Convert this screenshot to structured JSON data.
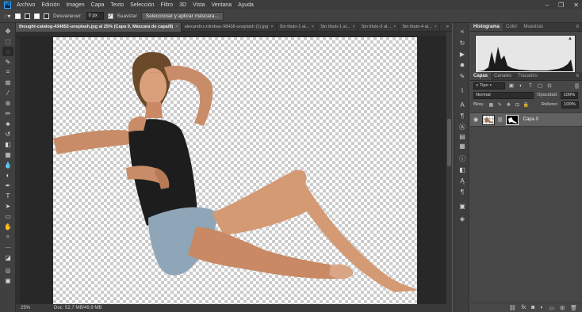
{
  "app": {
    "logo_text": "Ps"
  },
  "menu": [
    "Archivo",
    "Edición",
    "Imagen",
    "Capa",
    "Texto",
    "Selección",
    "Filtro",
    "3D",
    "Vista",
    "Ventana",
    "Ayuda"
  ],
  "options": {
    "feather_label": "Desvanecer:",
    "feather_value": "0 px",
    "smooth_label": "Suavizar",
    "select_mask_button": "Seleccionar y aplicar máscara..."
  },
  "tabs": [
    {
      "label": "thought-catalog-434852-unsplash.jpg al 25% (Capa 0, Máscara de capa/8)",
      "active": true
    },
    {
      "label": "alexandru-zdrobau-98438-unsplash (1).jpg",
      "active": false
    },
    {
      "label": "Sin título-1 al...",
      "active": false
    },
    {
      "label": "Sin título-1 al...",
      "active": false
    },
    {
      "label": "Sin título-3 al...",
      "active": false
    },
    {
      "label": "Sin título-4 al...",
      "active": false
    }
  ],
  "tabs_more": "»",
  "status": {
    "zoom": "25%",
    "doc_info": "Doc: 52,7 MB/49,9 MB"
  },
  "histogram_panel": {
    "tabs": [
      "Histograma",
      "Color",
      "Muestras"
    ],
    "active_tab": "Histograma",
    "warning_glyph": "▲"
  },
  "layers_panel": {
    "tabs": [
      "Capas",
      "Canales",
      "Trazados"
    ],
    "active_tab": "Capas",
    "kind_filter": "Tipo",
    "blend_mode": "Normal",
    "opacity_label": "Opacidad:",
    "opacity_value": "100%",
    "lock_label": "Bloq.:",
    "fill_label": "Relleno:",
    "fill_value": "100%",
    "layers": [
      {
        "name": "Capa 0",
        "visible": true,
        "has_mask": true
      }
    ]
  }
}
